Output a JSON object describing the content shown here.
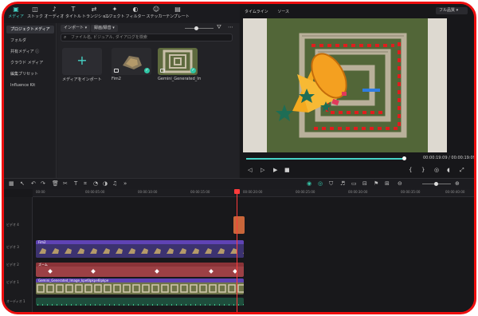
{
  "toolbar": {
    "items": [
      {
        "label": "メディア",
        "icon": "media-icon"
      },
      {
        "label": "ストック",
        "icon": "stock-icon"
      },
      {
        "label": "オーディオ",
        "icon": "music-note-icon"
      },
      {
        "label": "タイトル",
        "icon": "text-icon"
      },
      {
        "label": "トランジション",
        "icon": "transition-icon"
      },
      {
        "label": "エフェクト",
        "icon": "effect-icon"
      },
      {
        "label": "フィルター",
        "icon": "filter-icon"
      },
      {
        "label": "ステッカー",
        "icon": "sticker-icon"
      },
      {
        "label": "テンプレート",
        "icon": "template-icon"
      }
    ]
  },
  "sidebar": {
    "items": [
      {
        "label": "プロジェクトメディア",
        "selected": true
      },
      {
        "label": "フォルダ"
      },
      {
        "label": "共有メディア ⓘ"
      },
      {
        "label": "クラウド メディア"
      },
      {
        "label": "編集プリセット"
      },
      {
        "label": "Influence Kit"
      }
    ]
  },
  "media": {
    "import_label": "インポート ▾",
    "record_label": "録画/録音 ▾",
    "search_placeholder": "ファイル名, ビジュアル, ダイアログを検索",
    "import_card_label": "メディアをインポート",
    "items": [
      {
        "name": "Fim2"
      },
      {
        "name": "Gemini_Generated_Ima..."
      }
    ]
  },
  "preview": {
    "tabs": [
      "タイムライン",
      "ソース"
    ],
    "quality": "フル品質 ▾",
    "timecode": "00:00:19:09",
    "duration": "00:00:19:09",
    "separator": "/",
    "progress": 0.99
  },
  "timeline": {
    "ruler_ticks": [
      "00:00",
      "00:00:05:00",
      "00:00:10:00",
      "00:00:15:00",
      "00:00:20:00",
      "00:00:25:00",
      "00:00:30:00",
      "00:00:35:00",
      "00:00:40:00"
    ],
    "track_labels": [
      "ビデオ 4",
      "ビデオ 3",
      "ビデオ 2",
      "ビデオ 1",
      "オーディオ 1"
    ],
    "clips": {
      "fim2": "Fim2",
      "effect": "ズーム",
      "gemini": "Gemini_Generated_Image_kpe6lpkpe6lpkpe"
    }
  },
  "colors": {
    "accent": "#46d3c6",
    "purple_clip": "#5f43b4",
    "red_clip": "#9c4045",
    "frame_border": "#ee1010"
  }
}
